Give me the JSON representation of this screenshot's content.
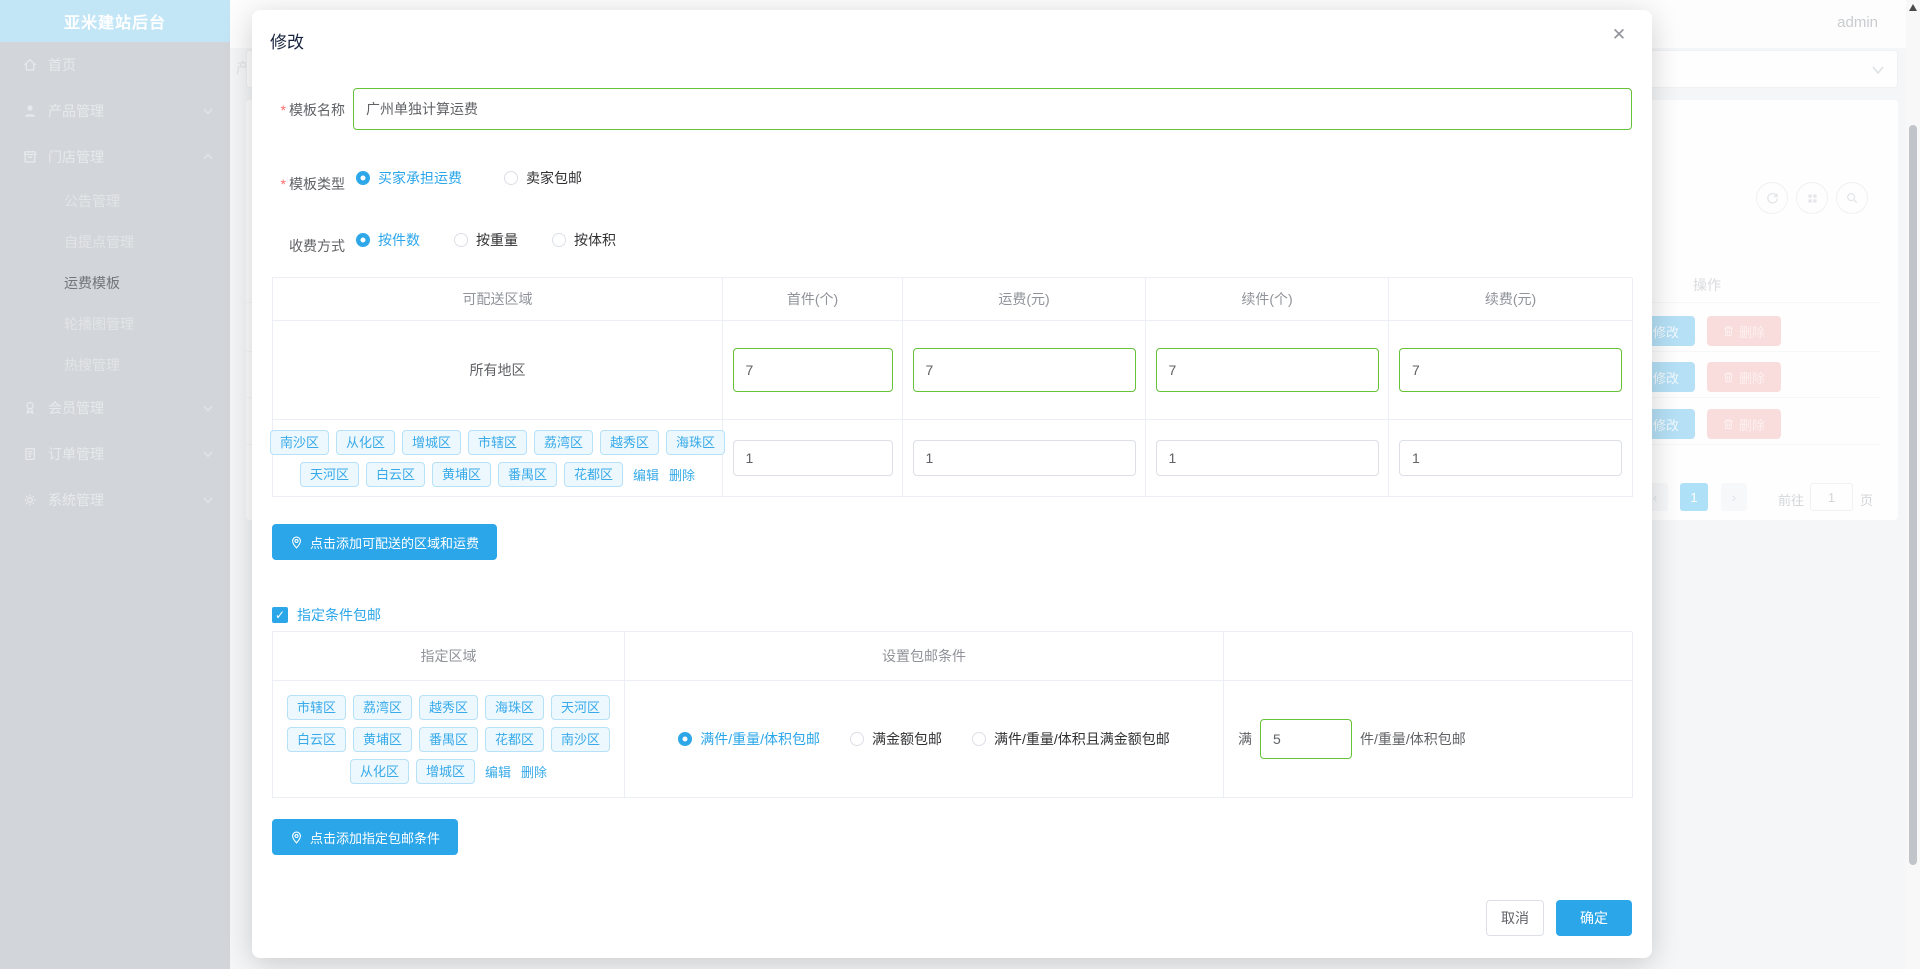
{
  "colors": {
    "accent_blue": "#2ba6e9",
    "success_green": "#67c23a",
    "danger_red": "#f56c6c"
  },
  "sidebar": {
    "title": "亚米建站后台",
    "menu": [
      {
        "label": "首页",
        "icon": "home-icon"
      },
      {
        "label": "产品管理",
        "icon": "user-icon"
      },
      {
        "label": "门店管理",
        "icon": "shop-icon"
      },
      {
        "label": "会员管理",
        "icon": "medal-icon"
      },
      {
        "label": "订单管理",
        "icon": "order-icon"
      },
      {
        "label": "系统管理",
        "icon": "gear-icon"
      }
    ],
    "store_submenu": [
      "公告管理",
      "自提点管理",
      "运费模板",
      "轮播图管理",
      "热搜管理"
    ],
    "active_item": "运费模板"
  },
  "topbar": {
    "username": "admin"
  },
  "background": {
    "breadcrumb_partial": "产",
    "toolbar_icons": [
      "refresh-icon",
      "grid-icon",
      "search-icon"
    ],
    "table": {
      "ops_header": "操作",
      "edit_label": "修改",
      "delete_label": "删除",
      "visible_rows": 3
    },
    "pagination": {
      "prev": "‹",
      "current_page": "1",
      "next": "›",
      "goto_label": "前往",
      "goto_value": "1",
      "unit_label": "页"
    }
  },
  "modal": {
    "title": "修改",
    "close_icon": "close-icon",
    "name_field": {
      "label": "模板名称",
      "value": "广州单独计算运费"
    },
    "type_field": {
      "label": "模板类型",
      "options": [
        "买家承担运费",
        "卖家包邮"
      ],
      "selected": "买家承担运费"
    },
    "charge_field": {
      "label": "收费方式",
      "options": [
        "按件数",
        "按重量",
        "按体积"
      ],
      "selected": "按件数"
    },
    "fee_table": {
      "headers": [
        "可配送区域",
        "首件(个)",
        "运费(元)",
        "续件(个)",
        "续费(元)"
      ],
      "row_all": {
        "region": "所有地区",
        "values": [
          "7",
          "7",
          "7",
          "7"
        ]
      },
      "row_districts": {
        "tags_line1": [
          "南沙区",
          "从化区",
          "增城区",
          "市辖区",
          "荔湾区",
          "越秀区",
          "海珠区"
        ],
        "tags_line2": [
          "天河区",
          "白云区",
          "黄埔区",
          "番禺区",
          "花都区"
        ],
        "edit_label": "编辑",
        "delete_label": "删除",
        "values": [
          "1",
          "1",
          "1",
          "1"
        ]
      }
    },
    "add_region_button": "点击添加可配送的区域和运费",
    "free_shipping_checkbox": {
      "label": "指定条件包邮",
      "checked": true
    },
    "condition_table": {
      "headers": [
        "指定区域",
        "设置包邮条件"
      ],
      "row": {
        "tags_line1": [
          "市辖区",
          "荔湾区",
          "越秀区",
          "海珠区",
          "天河区"
        ],
        "tags_line2": [
          "白云区",
          "黄埔区",
          "番禺区",
          "花都区",
          "南沙区"
        ],
        "tags_line3": [
          "从化区",
          "增城区"
        ],
        "edit_label": "编辑",
        "delete_label": "删除",
        "options": [
          "满件/重量/体积包邮",
          "满金额包邮",
          "满件/重量/体积且满金额包邮"
        ],
        "selected": "满件/重量/体积包邮",
        "threshold": {
          "prefix": "满",
          "value": "5",
          "suffix": "件/重量/体积包邮"
        }
      }
    },
    "add_condition_button": "点击添加指定包邮条件",
    "footer": {
      "cancel": "取消",
      "confirm": "确定"
    }
  }
}
